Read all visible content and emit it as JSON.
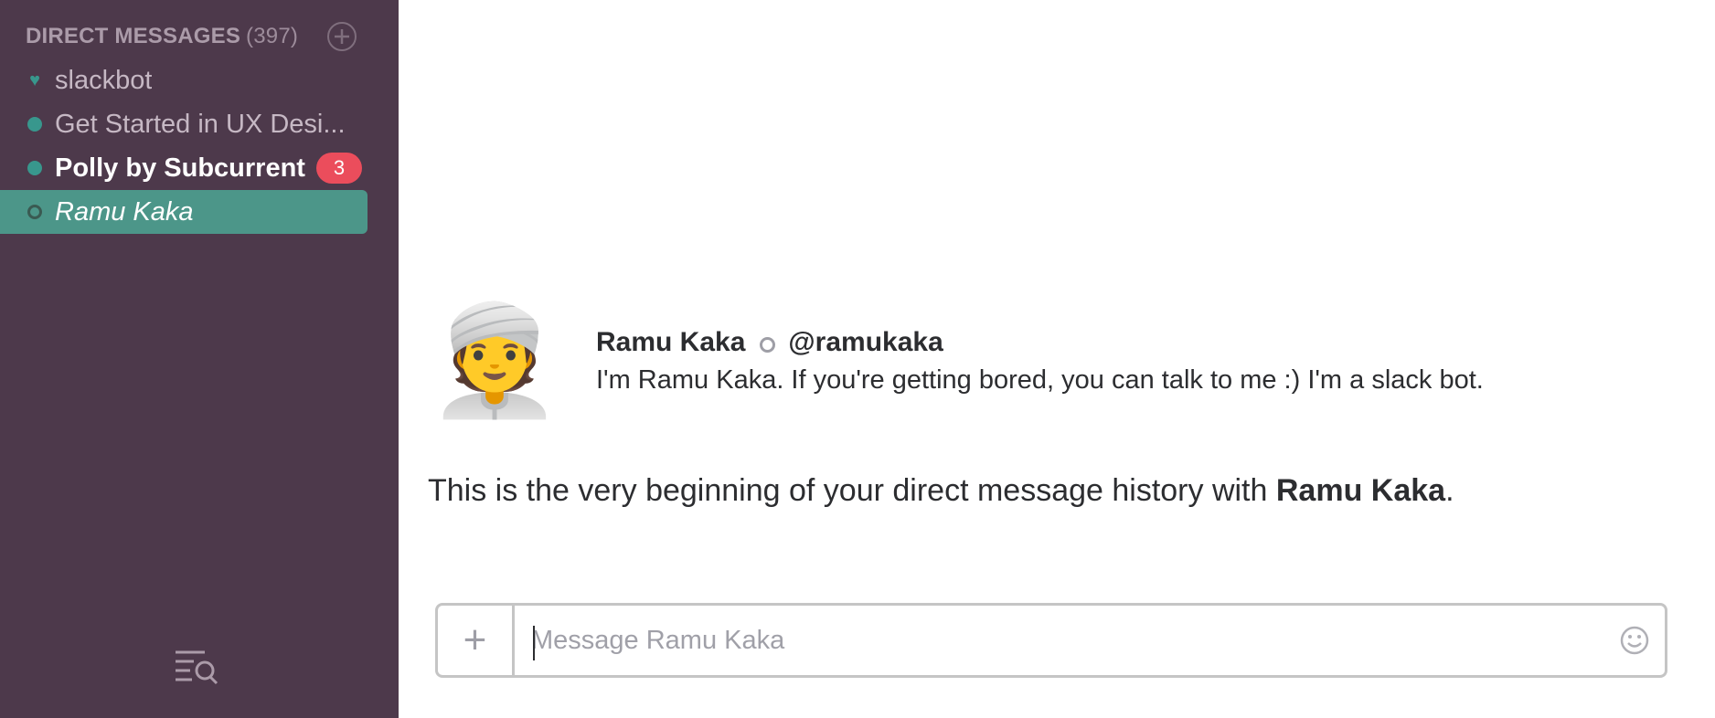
{
  "sidebar": {
    "section_title": "DIRECT MESSAGES",
    "section_count": "(397)",
    "add_icon": "plus-circle-icon",
    "items": [
      {
        "label": "slackbot",
        "status": "heart"
      },
      {
        "label": "Get Started in UX Desi...",
        "status": "online"
      },
      {
        "label": "Polly by Subcurrent",
        "status": "online",
        "badge": "3"
      },
      {
        "label": "Ramu Kaka",
        "status": "away"
      }
    ],
    "footer_icon": "search-list-icon"
  },
  "profile": {
    "avatar": "👳",
    "name": "Ramu Kaka",
    "handle": "@ramukaka",
    "description": "I'm Ramu Kaka. If you're getting bored, you can talk to me :) I'm a slack bot."
  },
  "history": {
    "prefix": "This is the very beginning of your direct message history with ",
    "name": "Ramu Kaka",
    "suffix": "."
  },
  "composer": {
    "plus_label": "+",
    "placeholder": "Message Ramu Kaka",
    "emoji_icon": "smiley-icon"
  },
  "colors": {
    "sidebar_bg": "#4d394b",
    "active_item": "#4c9689",
    "badge": "#eb4d5c",
    "online": "#38978d"
  }
}
